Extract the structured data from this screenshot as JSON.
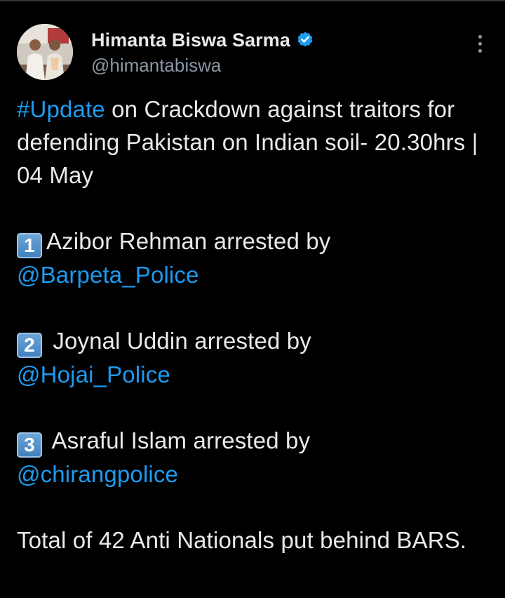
{
  "author": {
    "display_name": "Himanta Biswa Sarma",
    "handle": "@himantabiswa",
    "verified": true,
    "verified_color": "#1d9bf0"
  },
  "tweet": {
    "line1_hashtag": "#Update",
    "line1_rest": " on Crackdown against traitors for defending Pakistan on Indian soil- 20.30hrs | 04 May",
    "items": [
      {
        "number": "1",
        "text": "Azibor Rehman arrested by",
        "mention": "@Barpeta_Police"
      },
      {
        "number": "2",
        "text": " Joynal Uddin arrested by",
        "mention": "@Hojai_Police"
      },
      {
        "number": "3",
        "text": " Asraful Islam arrested by",
        "mention": "@chirangpolice"
      }
    ],
    "closing": "Total of 42 Anti Nationals put behind BARS."
  },
  "colors": {
    "background": "#000000",
    "text": "#e7e9ea",
    "secondary_text": "#8b98a5",
    "link": "#1d9bf0"
  }
}
